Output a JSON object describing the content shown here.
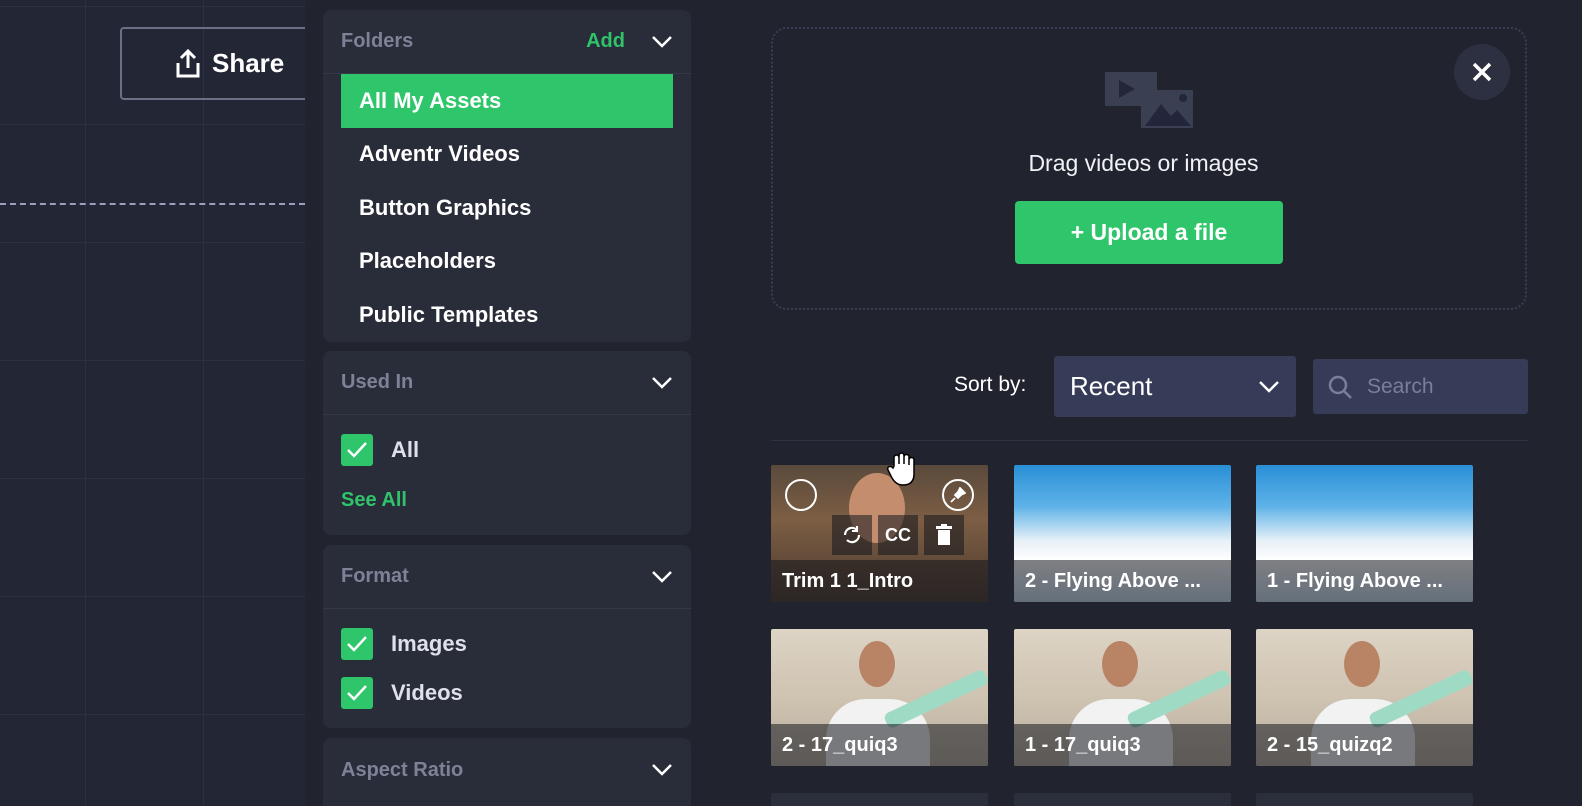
{
  "toolbar": {
    "share_label": "Share"
  },
  "folders": {
    "title": "Folders",
    "add_label": "Add",
    "items": [
      {
        "label": "All My Assets",
        "active": true
      },
      {
        "label": "Adventr Videos"
      },
      {
        "label": "Button Graphics"
      },
      {
        "label": "Placeholders"
      },
      {
        "label": "Public Templates"
      }
    ]
  },
  "used_in": {
    "title": "Used In",
    "options": [
      {
        "label": "All",
        "checked": true
      }
    ],
    "see_all_label": "See All"
  },
  "format": {
    "title": "Format",
    "options": [
      {
        "label": "Images",
        "checked": true
      },
      {
        "label": "Videos",
        "checked": true
      }
    ]
  },
  "aspect_ratio": {
    "title": "Aspect Ratio"
  },
  "upload": {
    "drag_text": "Drag videos or images",
    "button_label": "+ Upload a file"
  },
  "sort": {
    "label": "Sort by:",
    "selected": "Recent"
  },
  "search": {
    "placeholder": "Search"
  },
  "assets": [
    {
      "name": "Trim 1 1_Intro",
      "kind": "person",
      "cc_label": "CC"
    },
    {
      "name": "2 - Flying Above ...",
      "kind": "sky"
    },
    {
      "name": "1 - Flying Above ...",
      "kind": "sky"
    },
    {
      "name": "2 - 17_quiq3",
      "kind": "guitar"
    },
    {
      "name": "1 - 17_quiq3",
      "kind": "guitar"
    },
    {
      "name": "2 - 15_quizq2",
      "kind": "guitar"
    }
  ],
  "colors": {
    "accent": "#2fc56b",
    "panel": "#292c39",
    "background": "#21242f",
    "select": "#363b57"
  }
}
